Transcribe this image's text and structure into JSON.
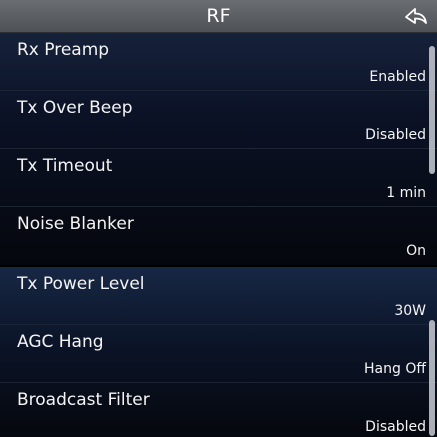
{
  "header": {
    "title": "RF",
    "back_icon": "back-arrow-icon"
  },
  "colors": {
    "header_bg": "#5d6065",
    "list_bg": "#0b1226",
    "text": "#f4f4f4",
    "scrollbar": "#c9cdd3"
  },
  "groups": [
    {
      "items": [
        {
          "label": "Rx Preamp",
          "value": "Enabled"
        },
        {
          "label": "Tx Over Beep",
          "value": "Disabled"
        },
        {
          "label": "Tx Timeout",
          "value": "1 min"
        },
        {
          "label": "Noise Blanker",
          "value": "On"
        }
      ]
    },
    {
      "items": [
        {
          "label": "Tx Power Level",
          "value": "30W"
        },
        {
          "label": "AGC Hang",
          "value": "Hang Off"
        },
        {
          "label": "Broadcast Filter",
          "value": "Disabled"
        }
      ]
    }
  ]
}
